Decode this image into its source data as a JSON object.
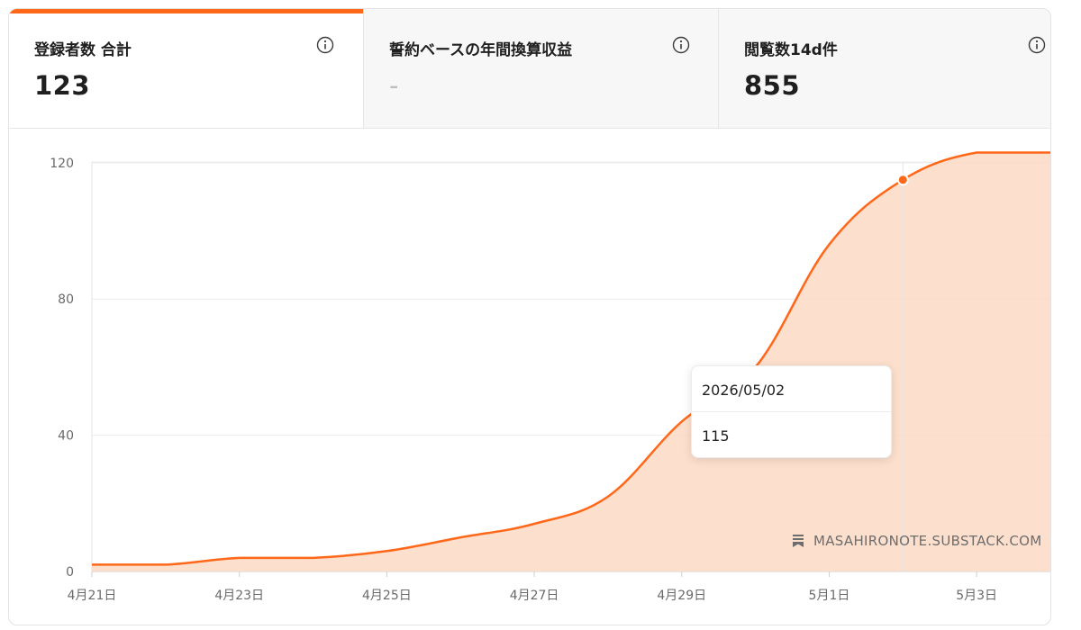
{
  "metrics": [
    {
      "label": "登録者数 合計",
      "value": "123",
      "active": true
    },
    {
      "label": "誓約ベースの年間換算収益",
      "value": "-",
      "active": false
    },
    {
      "label": "閲覧数14d件",
      "value": "855",
      "active": false
    }
  ],
  "tooltip": {
    "date": "2026/05/02",
    "value": "115"
  },
  "watermark": {
    "text": "MASAHIRONOTE.SUBSTACK.COM",
    "icon": "substack-bookmark-icon"
  },
  "colors": {
    "accent": "#ff6719",
    "area_fill": "#fdd9c4"
  },
  "chart_data": {
    "type": "area",
    "x": [
      "2026-04-21",
      "2026-04-22",
      "2026-04-23",
      "2026-04-24",
      "2026-04-25",
      "2026-04-26",
      "2026-04-27",
      "2026-04-28",
      "2026-04-29",
      "2026-04-30",
      "2026-05-01",
      "2026-05-02",
      "2026-05-03",
      "2026-05-04"
    ],
    "xticks": [
      "4月21日",
      "4月23日",
      "4月25日",
      "4月27日",
      "4月29日",
      "5月1日",
      "5月3日"
    ],
    "series": [
      {
        "values": [
          2,
          2,
          4,
          4,
          6,
          10,
          14,
          22,
          44,
          60,
          96,
          115,
          123,
          123
        ]
      }
    ],
    "yticks": [
      0,
      40,
      80,
      120
    ],
    "ylim": [
      0,
      130
    ],
    "grid": true,
    "highlight": {
      "x": "2026-05-02",
      "y": 115
    }
  }
}
